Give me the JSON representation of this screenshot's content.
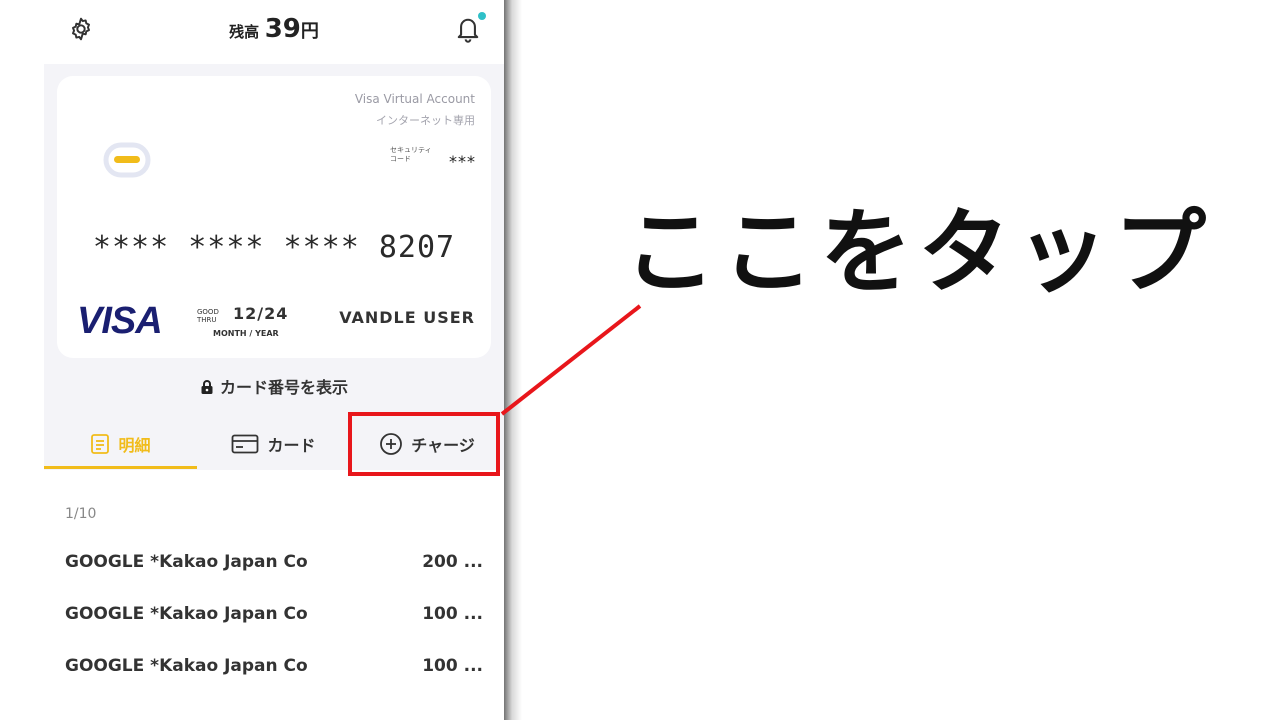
{
  "header": {
    "balance_label": "残高",
    "balance_amount": "39",
    "balance_unit": "円",
    "notification_dot_color": "#2fc0c8"
  },
  "card": {
    "account_type": "Visa Virtual Account",
    "usage_note": "インターネット専用",
    "security_label_line1": "セキュリティ",
    "security_label_line2": "コード",
    "security_value": "***",
    "number": "**** **** **** 8207",
    "brand": "VISA",
    "brand_color": "#1a1f71",
    "thru_label_line1": "GOOD",
    "thru_label_line2": "THRU",
    "expiry": "12/24",
    "expiry_caption": "MONTH / YEAR",
    "holder": "VANDLE USER"
  },
  "show_number_label": "カード番号を表示",
  "tabs": [
    {
      "label": "明細",
      "icon": "document-icon",
      "active": true
    },
    {
      "label": "カード",
      "icon": "credit-card-icon",
      "active": false
    },
    {
      "label": "チャージ",
      "icon": "plus-circle-icon",
      "active": false
    }
  ],
  "accent_color": "#f1bc1a",
  "list": {
    "page_count": "1/10",
    "rows": [
      {
        "merchant": "GOOGLE *Kakao Japan Co",
        "amount": "200 ..."
      },
      {
        "merchant": "GOOGLE *Kakao Japan Co",
        "amount": "100 ..."
      },
      {
        "merchant": "GOOGLE *Kakao Japan Co",
        "amount": "100 ..."
      }
    ]
  },
  "annotation": {
    "text": "ここをタップ",
    "highlight_color": "#e8161b"
  }
}
